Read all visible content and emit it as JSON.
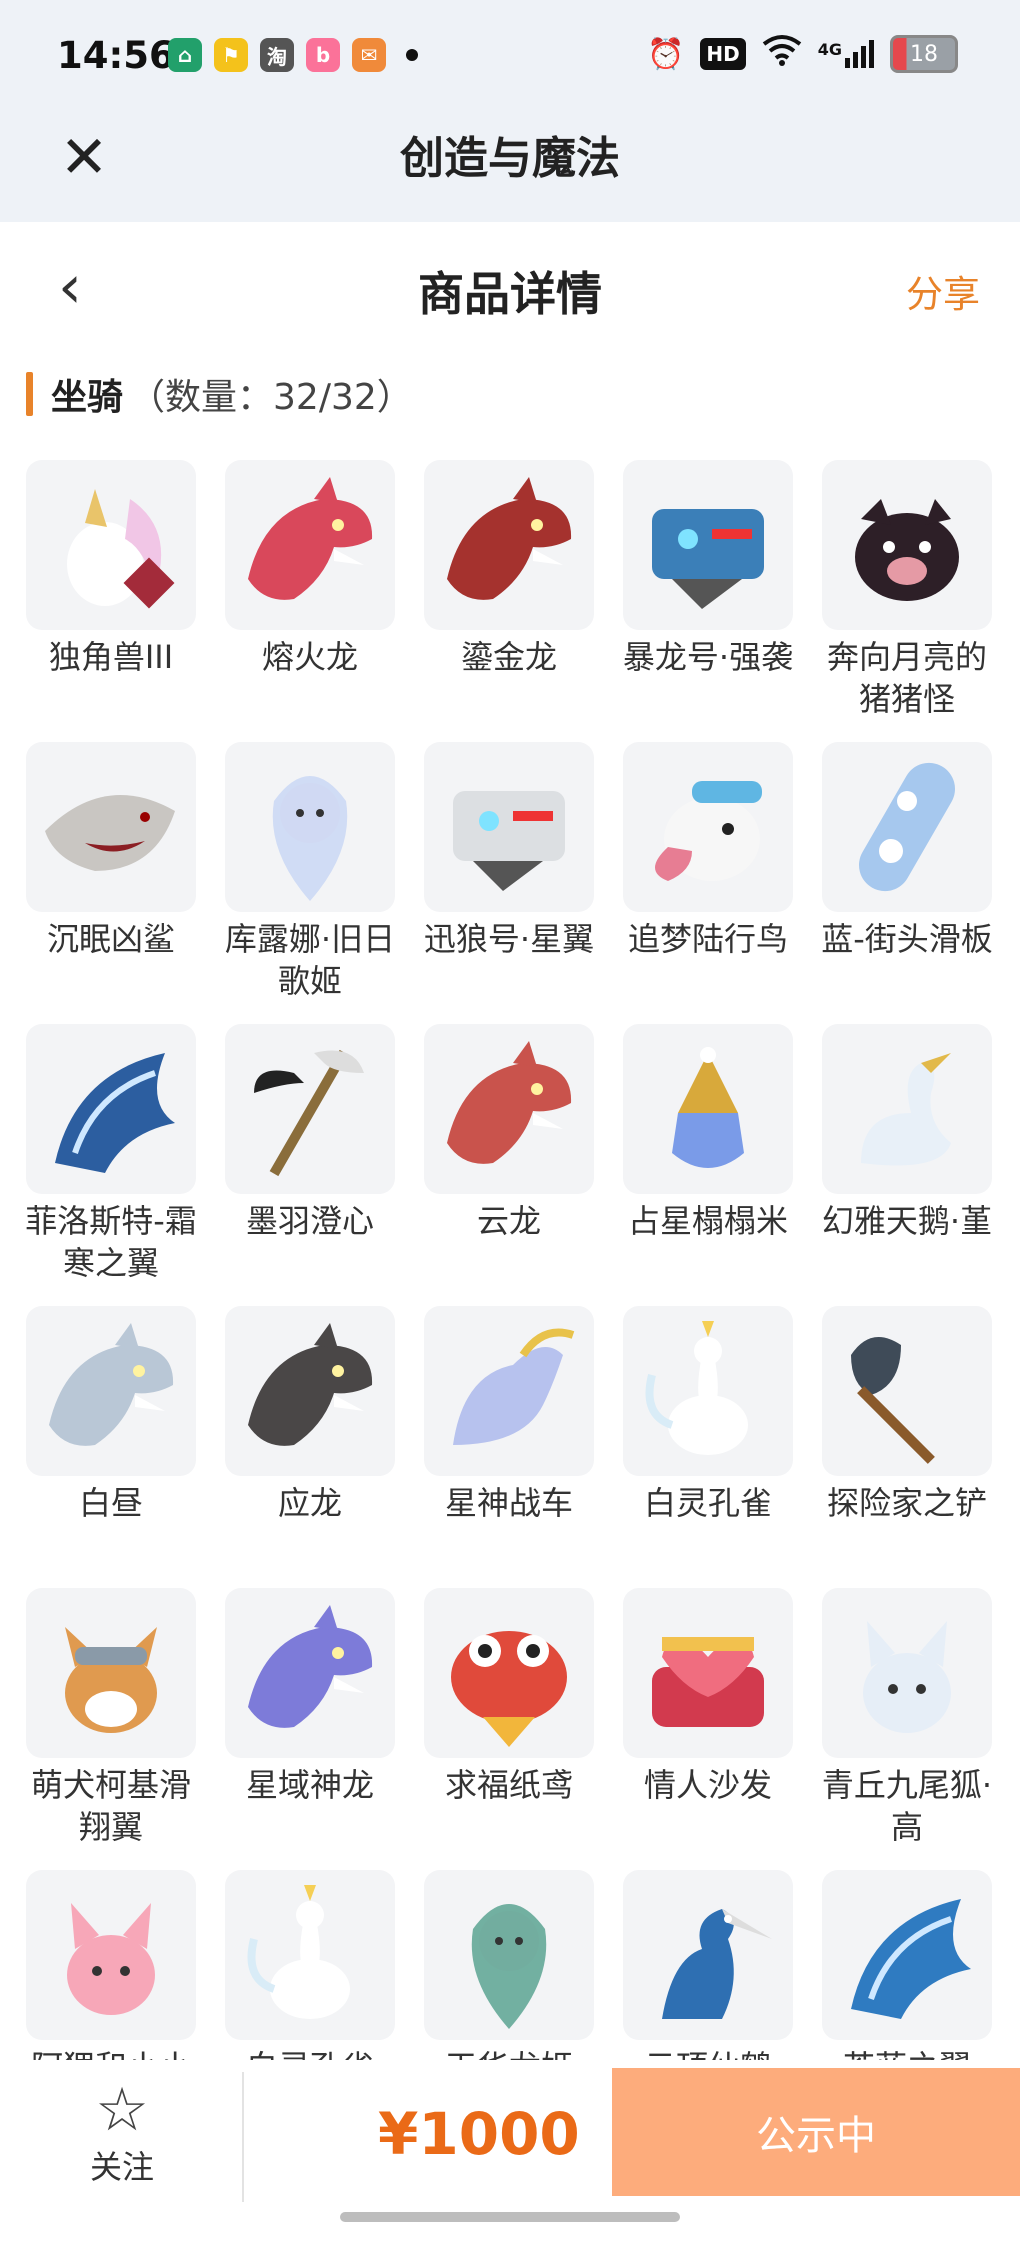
{
  "status_bar": {
    "time": "14:56",
    "notifications": [
      {
        "name": "home-app-icon",
        "text": "⌂",
        "color": "#22a06b"
      },
      {
        "name": "taxi-app-icon",
        "text": "⚑",
        "color": "#f4c21b"
      },
      {
        "name": "taobao-app-icon",
        "text": "淘",
        "color": "#555555"
      },
      {
        "name": "bilibili-app-icon",
        "text": "b",
        "color": "#fb7299"
      },
      {
        "name": "mail-app-icon",
        "text": "✉",
        "color": "#f08a3a"
      }
    ],
    "network": "4G",
    "hd": "HD",
    "battery": "18"
  },
  "app_bar": {
    "title": "创造与魔法"
  },
  "page_header": {
    "title": "商品详情",
    "share": "分享"
  },
  "section": {
    "label": "坐骑",
    "count": "（数量：32/32）"
  },
  "items": [
    {
      "name": "独角兽III",
      "icon": "unicorn",
      "color": "#f1c6e6"
    },
    {
      "name": "熔火龙",
      "icon": "dragon",
      "color": "#d9485b"
    },
    {
      "name": "鎏金龙",
      "icon": "dragon",
      "color": "#a5322e"
    },
    {
      "name": "暴龙号·强袭",
      "icon": "mech",
      "color": "#3b7fb8"
    },
    {
      "name": "奔向月亮的猪猪怪",
      "icon": "pig",
      "color": "#2d1f27"
    },
    {
      "name": "沉眠凶鲨",
      "icon": "shark",
      "color": "#c9c6c2"
    },
    {
      "name": "库露娜·旧日歌姬",
      "icon": "fairy",
      "color": "#c9d7f5"
    },
    {
      "name": "迅狼号·星翼",
      "icon": "mech",
      "color": "#dcdfe2"
    },
    {
      "name": "追梦陆行鸟",
      "icon": "bird",
      "color": "#e77d93"
    },
    {
      "name": "蓝-街头滑板",
      "icon": "skateboard",
      "color": "#a6c8ee"
    },
    {
      "name": "菲洛斯特-霜寒之翼",
      "icon": "wing",
      "color": "#2c5ea0"
    },
    {
      "name": "墨羽澄心",
      "icon": "staff",
      "color": "#8a6d3b"
    },
    {
      "name": "云龙",
      "icon": "dragon",
      "color": "#c9534c"
    },
    {
      "name": "占星榻榻米",
      "icon": "orb",
      "color": "#d8a93b"
    },
    {
      "name": "幻雅天鹅·堇",
      "icon": "swan",
      "color": "#e8f0f8"
    },
    {
      "name": "白昼",
      "icon": "dragon",
      "color": "#b9c7d6"
    },
    {
      "name": "应龙",
      "icon": "dragon",
      "color": "#4a4747"
    },
    {
      "name": "星神战车",
      "icon": "horse",
      "color": "#b7c2ee"
    },
    {
      "name": "白灵孔雀",
      "icon": "peacock",
      "color": "#d9ecf7"
    },
    {
      "name": "探险家之铲",
      "icon": "shovel",
      "color": "#3f4b58"
    },
    {
      "name": "萌犬柯基滑翔翼",
      "icon": "dog",
      "color": "#e09a4f"
    },
    {
      "name": "星域神龙",
      "icon": "dragon",
      "color": "#7d7bd9"
    },
    {
      "name": "求福纸鸢",
      "icon": "fish",
      "color": "#e04a3b"
    },
    {
      "name": "情人沙发",
      "icon": "sofa",
      "color": "#d23a4e"
    },
    {
      "name": "青丘九尾狐·高",
      "icon": "fox",
      "color": "#e6eef7"
    },
    {
      "name": "阿狸和小小云·高",
      "icon": "fox",
      "color": "#f7a7b8"
    },
    {
      "name": "白灵孔雀",
      "icon": "peacock",
      "color": "#d9ecf7"
    },
    {
      "name": "天华龙姬",
      "icon": "fairy",
      "color": "#5aa392"
    },
    {
      "name": "云顶仙鹤",
      "icon": "crane",
      "color": "#2e6fb2"
    },
    {
      "name": "苍蓝之翼",
      "icon": "wing",
      "color": "#2f7bc1"
    }
  ],
  "bottom_bar": {
    "follow_label": "关注",
    "price": "¥1000",
    "status_button": "公示中"
  }
}
